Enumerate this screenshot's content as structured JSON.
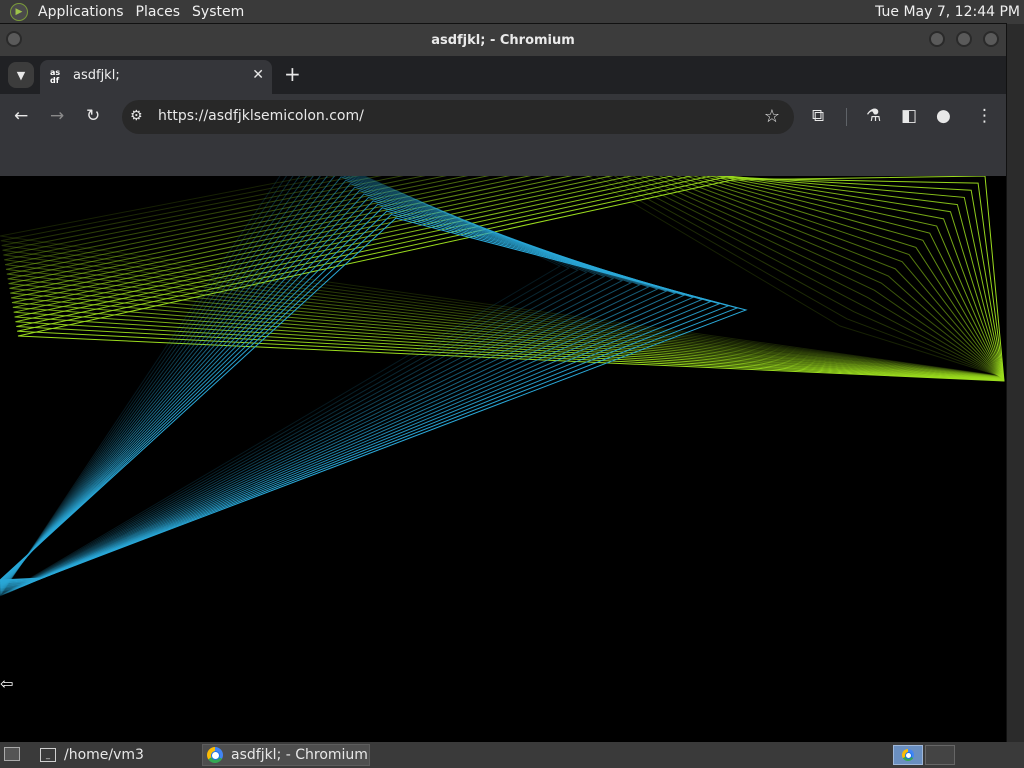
{
  "top_panel": {
    "menu": [
      "Applications",
      "Places",
      "System"
    ],
    "clock": "Tue May  7, 12:44 PM"
  },
  "window": {
    "title": "asdfjkl; - Chromium"
  },
  "browser": {
    "tab": {
      "favicon_text": "as\ndf",
      "title": "asdfjkl;"
    },
    "omnibox": {
      "url": "https://asdfjklsemicolon.com/"
    },
    "icons": {
      "back": "arrow-left-icon",
      "forward": "arrow-right-icon",
      "reload": "reload-icon",
      "site_info": "tune-icon",
      "bookmark": "star-icon",
      "extensions": "puzzle-icon",
      "labs": "flask-icon",
      "side_panel": "side-panel-icon",
      "profile": "person-icon",
      "menu": "more-vert-icon"
    }
  },
  "page": {
    "background": "#000000",
    "colors": {
      "green_lines": "#9bdc1e",
      "blue_lines": "#2aa8d8"
    }
  },
  "taskbar": {
    "tasks": [
      {
        "label": "/home/vm3",
        "active": false
      },
      {
        "label": "asdfjkl; - Chromium",
        "active": true
      }
    ]
  }
}
